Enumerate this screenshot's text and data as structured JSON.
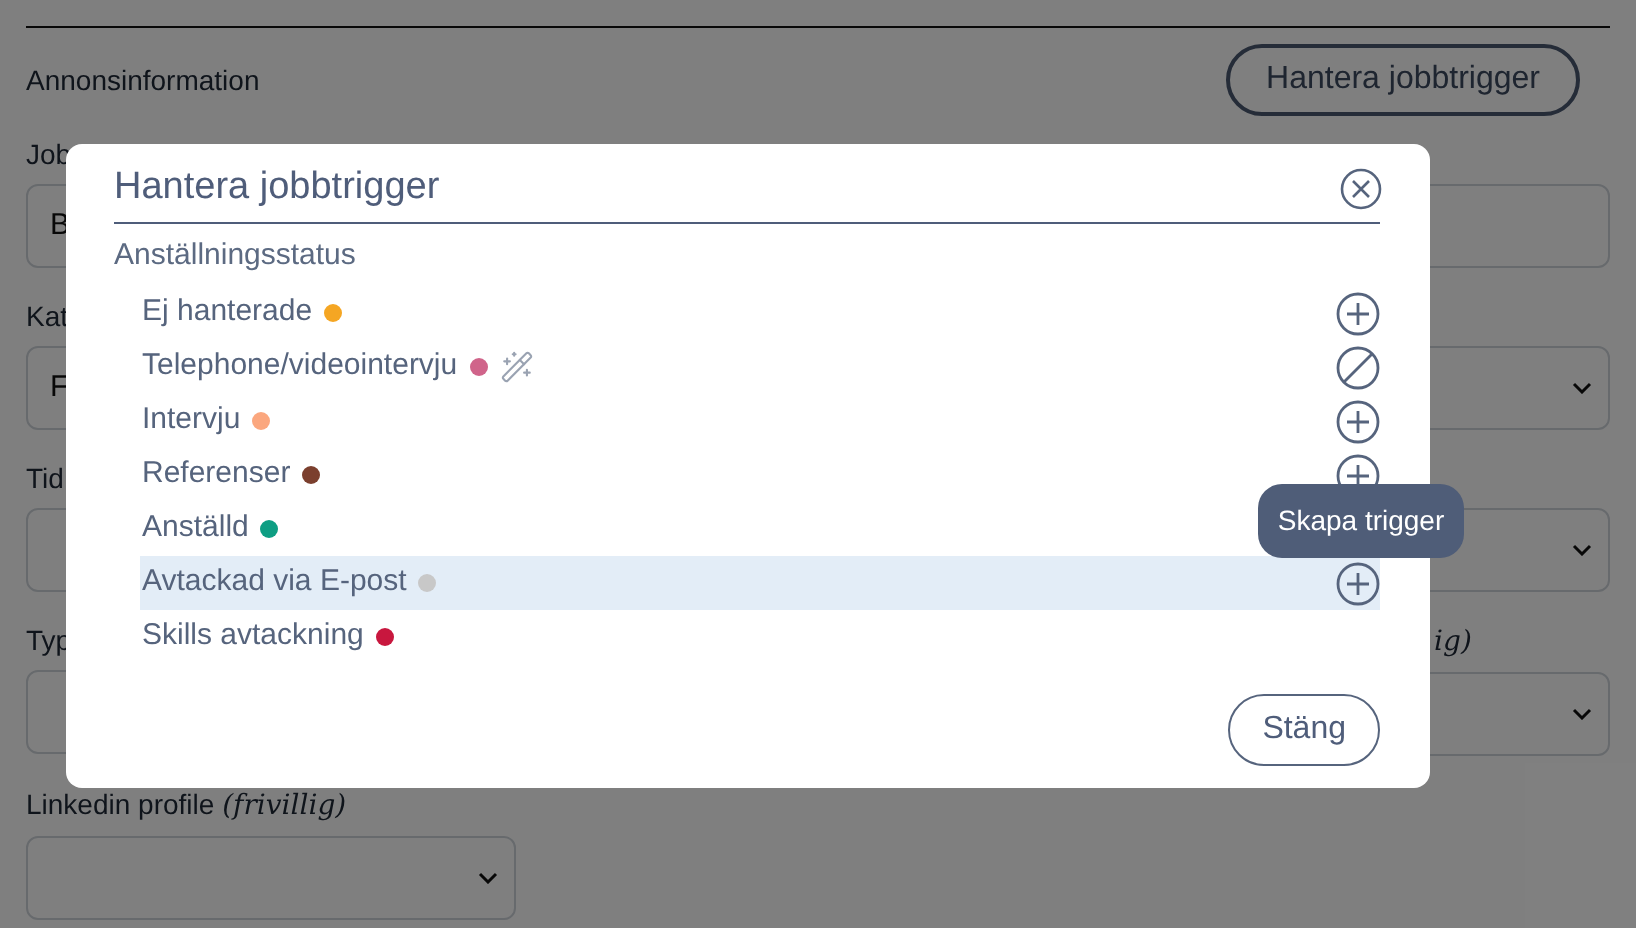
{
  "form": {
    "section_title": "Annonsinformation",
    "manage_button": "Hantera jobbtrigger",
    "rows": [
      {
        "kind": "full",
        "fields": [
          {
            "label": "Job",
            "value": "B",
            "kind": "input"
          }
        ]
      },
      {
        "kind": "pair",
        "fields": [
          {
            "label": "Kat",
            "value": "F",
            "kind": "input"
          },
          {
            "kind": "select"
          }
        ]
      },
      {
        "kind": "pair",
        "fields": [
          {
            "label": "Tid",
            "kind": "input"
          },
          {
            "kind": "select"
          }
        ]
      },
      {
        "kind": "pair",
        "fields": [
          {
            "label": "Typ",
            "kind": "input"
          },
          {
            "hint": "ig)",
            "kind": "select"
          }
        ]
      },
      {
        "kind": "single",
        "fields": [
          {
            "label": "Linkedin profile",
            "hint": "(frivillig)",
            "kind": "select"
          }
        ]
      }
    ]
  },
  "dialog": {
    "title": "Hantera jobbtrigger",
    "subtitle": "Anställningsstatus",
    "statuses": [
      {
        "name": "Ej hanterade",
        "color": "#f5a623",
        "automated": false,
        "kind": "addable",
        "selected": false
      },
      {
        "name": "Telephone/videointervju",
        "color": "#d0648a",
        "automated": true,
        "kind": "blocked",
        "selected": false
      },
      {
        "name": "Intervju",
        "color": "#fba77e",
        "automated": false,
        "kind": "addable",
        "selected": false
      },
      {
        "name": "Referenser",
        "color": "#7b3f2e",
        "automated": false,
        "kind": "addable",
        "selected": false
      },
      {
        "name": "Anställd",
        "color": "#0e9e83",
        "automated": false,
        "kind": "plain",
        "selected": false
      },
      {
        "name": "Avtackad via E-post",
        "color": "#c8c8c8",
        "automated": false,
        "kind": "addable",
        "selected": true
      },
      {
        "name": "Skills avtackning",
        "color": "#c8173e",
        "automated": false,
        "kind": "plain",
        "selected": false
      }
    ],
    "close_button": "Stäng"
  },
  "tooltip": {
    "text": "Skapa trigger"
  }
}
